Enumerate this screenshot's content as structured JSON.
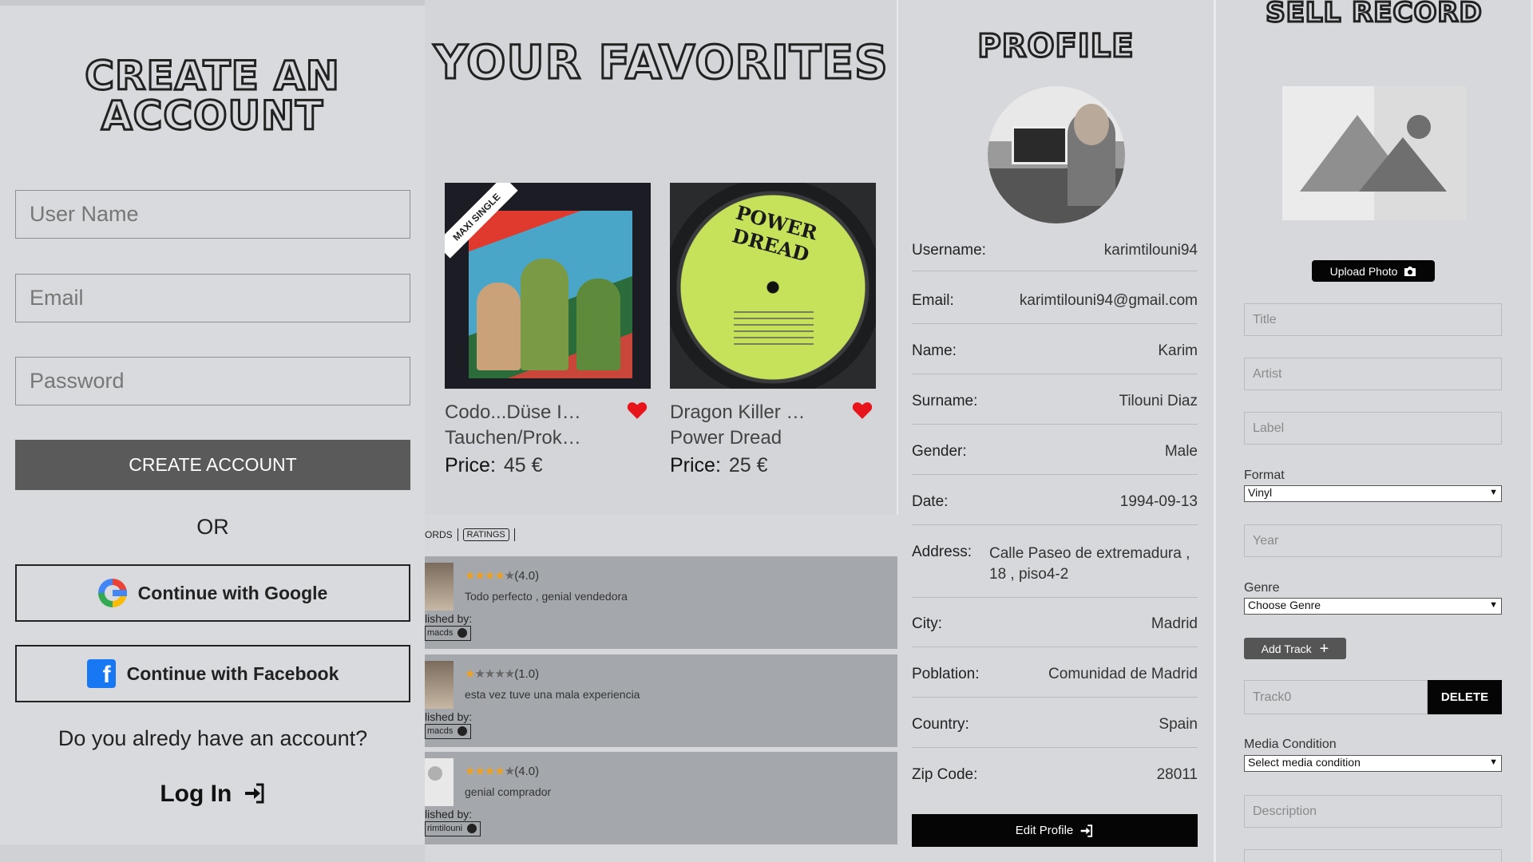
{
  "signup": {
    "title": "CREATE AN ACCOUNT",
    "username_placeholder": "User Name",
    "email_placeholder": "Email",
    "password_placeholder": "Password",
    "create_label": "CREATE ACCOUNT",
    "or_label": "OR",
    "google_label": "Continue with Google",
    "facebook_label": "Continue with Facebook",
    "have_account": "Do you alredy have an account?",
    "login_label": "Log In"
  },
  "favorites": {
    "title": "YOUR FAVORITES",
    "price_label": "Price:",
    "items": [
      {
        "title": "Codo...Düse I…",
        "artist": "Tauchen/Prok…",
        "price": "45 €",
        "cover_icon": "album-cover-icon"
      },
      {
        "title": "Dragon Killer …",
        "artist": "Power Dread",
        "price": "25 €",
        "cover_icon": "vinyl-record-icon",
        "label_text": "POWER DREAD"
      }
    ]
  },
  "ratings": {
    "tabs": [
      "ORDS",
      "RATINGS"
    ],
    "published_by": "lished by:",
    "items": [
      {
        "stars": 4,
        "score": "(4.0)",
        "comment": "Todo perfecto , genial vendedora",
        "user": "macds"
      },
      {
        "stars": 1,
        "score": "(1.0)",
        "comment": "esta vez tuve una mala experiencia",
        "user": "macds"
      },
      {
        "stars": 4,
        "score": "(4.0)",
        "comment": "genial comprador",
        "user": "rimtilouni"
      }
    ]
  },
  "profile": {
    "title": "PROFILE",
    "rows": [
      {
        "key": "Username:",
        "value": "karimtilouni94"
      },
      {
        "key": "Email:",
        "value": "karimtilouni94@gmail.com"
      },
      {
        "key": "Name:",
        "value": "Karim"
      },
      {
        "key": "Surname:",
        "value": "Tilouni Diaz"
      },
      {
        "key": "Gender:",
        "value": "Male"
      },
      {
        "key": "Date:",
        "value": "1994-09-13"
      },
      {
        "key": "Address:",
        "value": "Calle Paseo de extremadura , 18 , piso4-2"
      },
      {
        "key": "City:",
        "value": "Madrid"
      },
      {
        "key": "Poblation:",
        "value": "Comunidad de Madrid"
      },
      {
        "key": "Country:",
        "value": "Spain"
      },
      {
        "key": "Zip Code:",
        "value": "28011"
      }
    ],
    "edit_label": "Edit Profile"
  },
  "sell": {
    "title": "SELL RECORD",
    "upload_label": "Upload Photo",
    "title_placeholder": "Title",
    "artist_placeholder": "Artist",
    "label_placeholder": "Label",
    "format_label": "Format",
    "format_value": "Vinyl",
    "year_placeholder": "Year",
    "genre_label": "Genre",
    "genre_value": "Choose Genre",
    "add_track_label": "Add Track",
    "track_placeholder": "Track0",
    "delete_label": "DELETE",
    "media_condition_label": "Media Condition",
    "media_condition_value": "Select media condition",
    "description_placeholder": "Description"
  },
  "colors": {
    "accent_dark": "#050505",
    "button_gray": "#5a5a5a",
    "heart": "#e8141b",
    "star": "#f0a11b"
  }
}
